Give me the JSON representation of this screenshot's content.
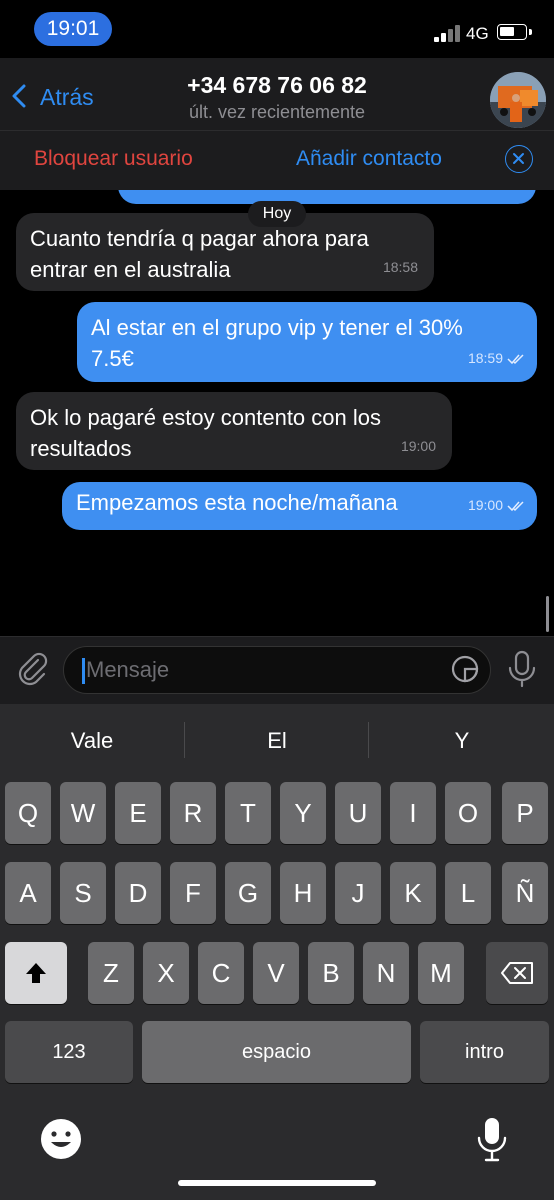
{
  "status": {
    "time": "19:01",
    "network": "4G"
  },
  "header": {
    "back_label": "Atrás",
    "title": "+34 678 76 06 82",
    "subtitle": "últ. vez recientemente"
  },
  "actions": {
    "block": "Bloquear usuario",
    "add_contact": "Añadir contacto"
  },
  "chat": {
    "date_label": "Hoy",
    "messages": [
      {
        "direction": "in",
        "line1": "Cuanto tendría q pagar ahora para",
        "line2": "entrar en el australia",
        "time": "18:58"
      },
      {
        "direction": "out",
        "line1": "Al estar en el grupo vip y tener el 30%",
        "line2": "7.5€",
        "time": "18:59"
      },
      {
        "direction": "in",
        "line1": "Ok lo pagaré estoy contento con los",
        "line2": "resultados",
        "time": "19:00"
      },
      {
        "direction": "out",
        "line1": "Empezamos esta noche/mañana",
        "line2": "",
        "time": "19:00"
      }
    ]
  },
  "input": {
    "placeholder": "Mensaje"
  },
  "keyboard": {
    "suggestions": [
      "Vale",
      "El",
      "Y"
    ],
    "row1": [
      "Q",
      "W",
      "E",
      "R",
      "T",
      "Y",
      "U",
      "I",
      "O",
      "P"
    ],
    "row2": [
      "A",
      "S",
      "D",
      "F",
      "G",
      "H",
      "J",
      "K",
      "L",
      "Ñ"
    ],
    "row3": [
      "Z",
      "X",
      "C",
      "V",
      "B",
      "N",
      "M"
    ],
    "numbers_key": "123",
    "space_key": "espacio",
    "return_key": "intro"
  },
  "colors": {
    "accent": "#2f8cf2",
    "outgoing_bubble": "#3f8ff1",
    "incoming_bubble": "#262628",
    "danger": "#e0453f"
  },
  "icons": [
    "back-chevron-icon",
    "close-icon",
    "attach-icon",
    "sticker-icon",
    "mic-icon",
    "shift-icon",
    "backspace-icon",
    "emoji-icon",
    "dictation-icon",
    "read-ticks-icon"
  ]
}
